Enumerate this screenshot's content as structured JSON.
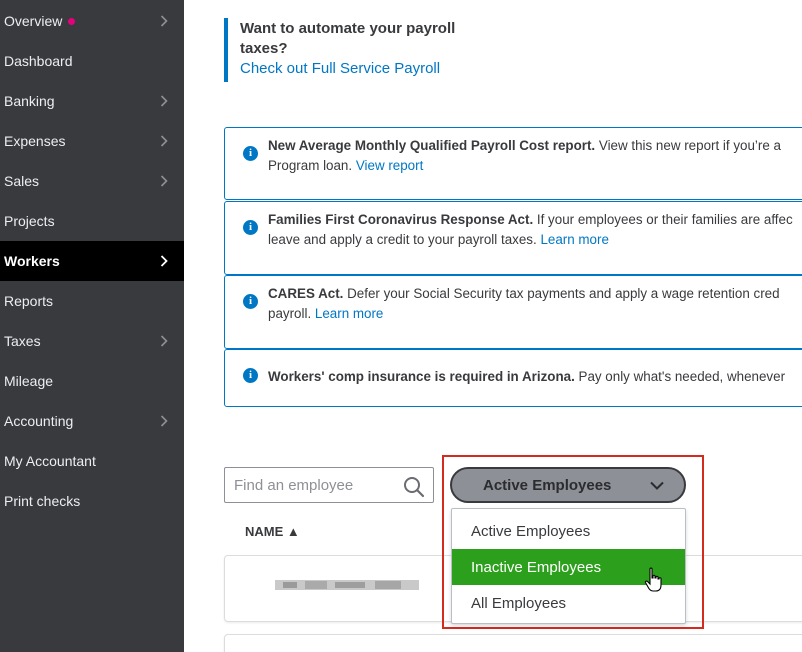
{
  "sidebar": {
    "items": [
      {
        "label": "Overview",
        "has_dot": true,
        "has_chevron": true,
        "active": false
      },
      {
        "label": "Dashboard",
        "has_chevron": false,
        "active": false
      },
      {
        "label": "Banking",
        "has_chevron": true,
        "active": false
      },
      {
        "label": "Expenses",
        "has_chevron": true,
        "active": false
      },
      {
        "label": "Sales",
        "has_chevron": true,
        "active": false
      },
      {
        "label": "Projects",
        "has_chevron": false,
        "active": false
      },
      {
        "label": "Workers",
        "has_chevron": true,
        "active": true
      },
      {
        "label": "Reports",
        "has_chevron": false,
        "active": false
      },
      {
        "label": "Taxes",
        "has_chevron": true,
        "active": false
      },
      {
        "label": "Mileage",
        "has_chevron": false,
        "active": false
      },
      {
        "label": "Accounting",
        "has_chevron": true,
        "active": false
      },
      {
        "label": "My Accountant",
        "has_chevron": false,
        "active": false
      },
      {
        "label": "Print checks",
        "has_chevron": false,
        "active": false
      }
    ],
    "colors": {
      "background": "#393a3d",
      "active_background": "#000000",
      "dot": "#e5007e"
    }
  },
  "promo": {
    "text": "Want to automate your payroll taxes?",
    "link": "Check out Full Service Payroll"
  },
  "notices": [
    {
      "bold": "New Average Monthly Qualified Payroll Cost report.",
      "text": " View this new report if you’re a",
      "line2": "Program loan. ",
      "link": "View report"
    },
    {
      "bold": "Families First Coronavirus Response Act.",
      "text": " If your employees or their families are affec",
      "line2": "leave and apply a credit to your payroll taxes. ",
      "link": "Learn more"
    },
    {
      "bold": "CARES Act.",
      "text": " Defer your Social Security tax payments and apply a wage retention cred",
      "line2": "payroll. ",
      "link": "Learn more"
    },
    {
      "bold": "Workers' comp insurance is required in Arizona.",
      "text": " Pay only what's needed, whenever"
    }
  ],
  "search": {
    "placeholder": "Find an employee",
    "value": "",
    "icon": "search-icon"
  },
  "filter": {
    "selected_label": "Active Employees",
    "options": [
      "Active Employees",
      "Inactive Employees",
      "All Employees"
    ],
    "highlighted_option": "Inactive Employees"
  },
  "table": {
    "column_name": "NAME ▲"
  },
  "colors": {
    "accent": "#0077c5",
    "highlight_green": "#2ca01c",
    "annotation_red": "#d52b1e"
  }
}
